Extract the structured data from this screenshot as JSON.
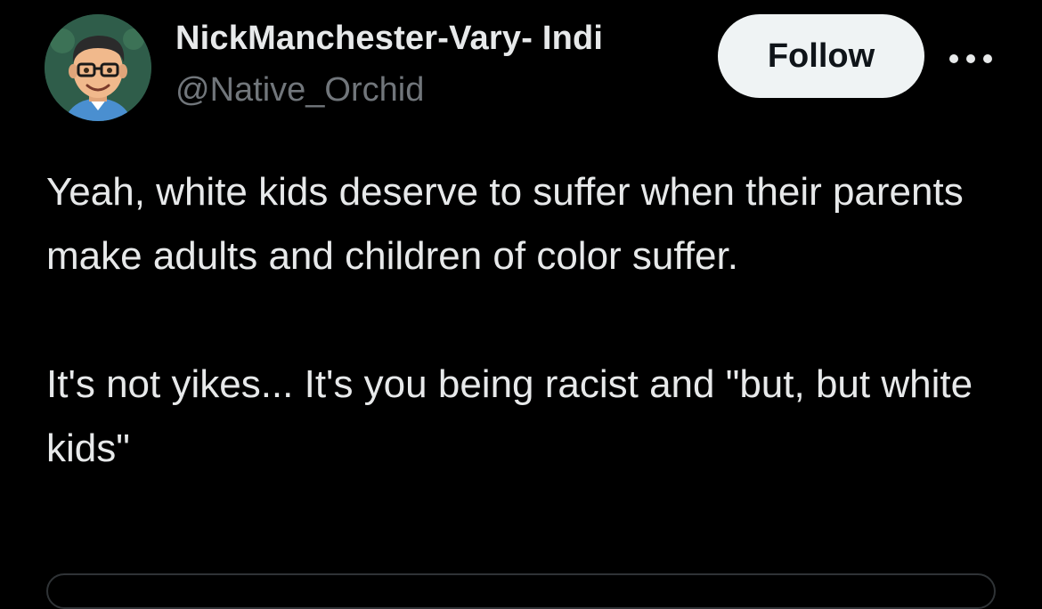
{
  "author": {
    "display_name": "NickManchester-Vary- Indi",
    "handle": "@Native_Orchid",
    "avatar_icon": "avatar-cartoon-glasses-icon"
  },
  "actions": {
    "follow_label": "Follow",
    "more_icon": "more-options-icon"
  },
  "tweet": {
    "paragraph_1": "Yeah, white kids deserve to suffer when their parents make adults and children of color suffer.",
    "paragraph_2": "It's not yikes... It's you being racist and \"but, but white kids\""
  },
  "colors": {
    "background": "#000000",
    "text_primary": "#e7e9ea",
    "text_secondary": "#71767b",
    "follow_bg": "#eff3f4",
    "follow_text": "#0f1419",
    "border": "#2f3336"
  }
}
